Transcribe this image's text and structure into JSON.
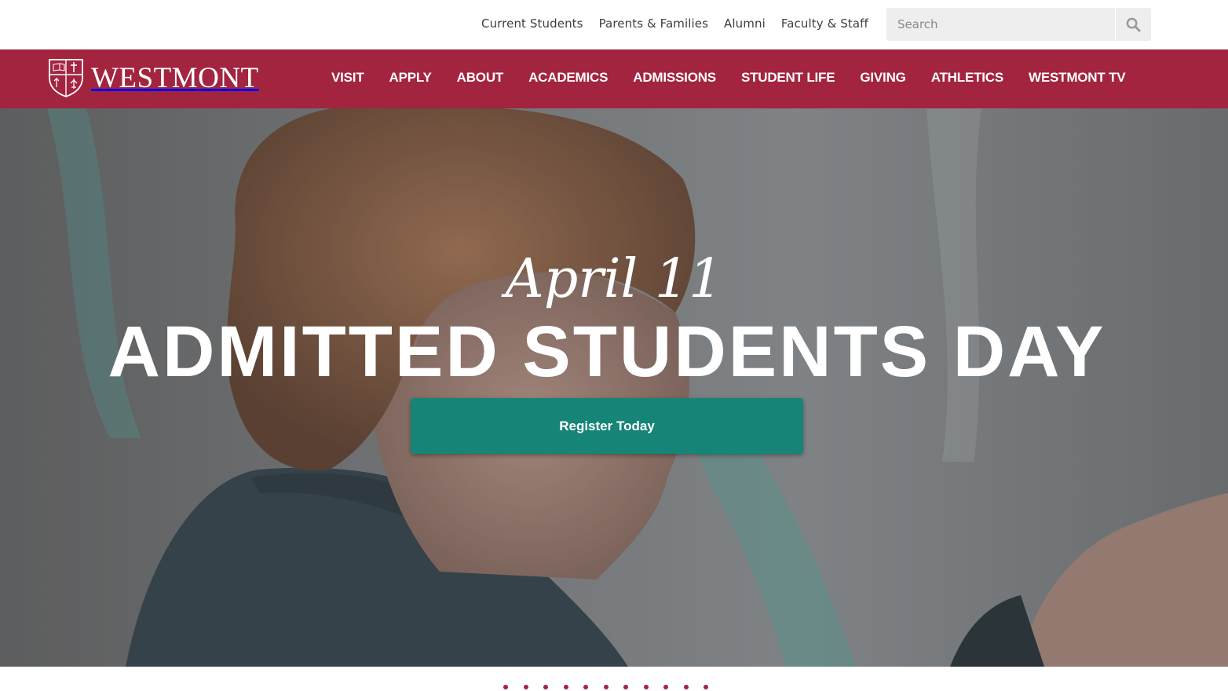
{
  "utility_nav": {
    "links": [
      "Current Students",
      "Parents & Families",
      "Alumni",
      "Faculty & Staff"
    ]
  },
  "search": {
    "placeholder": "Search",
    "icon": "search-icon"
  },
  "brand": {
    "name": "WESTMONT",
    "color": "#a2243f",
    "logo_icon": "shield-crest-icon"
  },
  "main_nav": {
    "items": [
      "VISIT",
      "APPLY",
      "ABOUT",
      "ACADEMICS",
      "ADMISSIONS",
      "STUDENT LIFE",
      "GIVING",
      "ATHLETICS",
      "WESTMONT TV"
    ]
  },
  "hero": {
    "date": "April 11",
    "title": "ADMITTED STUDENTS DAY",
    "cta_label": "Register Today",
    "cta_color": "#168477"
  },
  "carousel": {
    "dot_count": 11,
    "dot_color": "#a2243f"
  }
}
